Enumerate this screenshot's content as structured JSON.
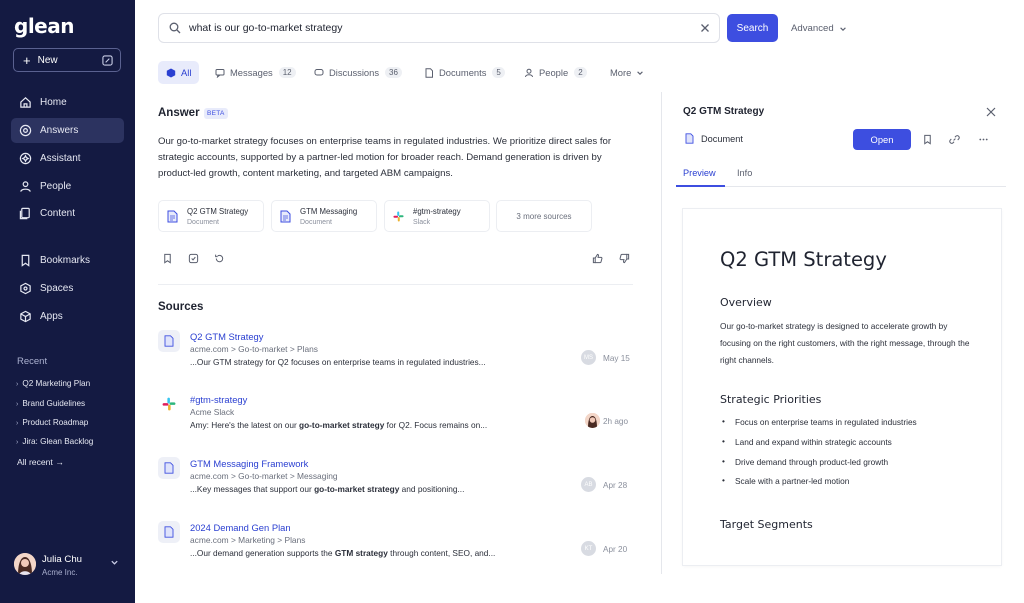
{
  "brand": {
    "logo": "glean",
    "primary_color": "#3d4ee0",
    "sidebar_color": "#141a42"
  },
  "sidebar": {
    "new_label": "New",
    "nav": [
      {
        "label": "Home",
        "icon": "home-icon"
      },
      {
        "label": "Answers",
        "icon": "answers-icon"
      },
      {
        "label": "Assistant",
        "icon": "assistant-icon"
      },
      {
        "label": "People",
        "icon": "people-icon"
      },
      {
        "label": "Content",
        "icon": "content-icon"
      }
    ],
    "nav2": [
      {
        "label": "Bookmarks",
        "icon": "bookmark-icon"
      },
      {
        "label": "Spaces",
        "icon": "spaces-icon"
      },
      {
        "label": "Apps",
        "icon": "apps-icon"
      }
    ],
    "recent_title": "Recent",
    "recent": [
      "Q2 Marketing Plan",
      "Brand Guidelines",
      "Product Roadmap",
      "Jira: Glean Backlog"
    ],
    "all_recent": "All recent →",
    "user": {
      "name": "Julia Chu",
      "org": "Acme Inc."
    }
  },
  "search": {
    "query": "what is our go-to-market strategy",
    "button": "Search",
    "advanced": "Advanced"
  },
  "tabs": [
    {
      "label": "All",
      "count": ""
    },
    {
      "label": "Messages",
      "count": "12"
    },
    {
      "label": "Discussions",
      "count": "36"
    },
    {
      "label": "Documents",
      "count": "5"
    },
    {
      "label": "People",
      "count": "2"
    },
    {
      "label": "More",
      "count": ""
    }
  ],
  "answer": {
    "title": "Answer",
    "badge": "BETA",
    "text": "Our go-to-market strategy focuses on enterprise teams in regulated industries. We prioritize direct sales for strategic accounts, supported by a partner-led motion for broader reach. Demand generation is driven by product-led growth, content marketing, and targeted ABM campaigns.",
    "cards": [
      {
        "title": "Q2 GTM Strategy",
        "sub": "Document"
      },
      {
        "title": "GTM Messaging",
        "sub": "Document"
      },
      {
        "title": "#gtm-strategy",
        "sub": "Slack"
      }
    ],
    "more_sources": "3 more sources"
  },
  "sources": {
    "title": "Sources",
    "items": [
      {
        "title": "Q2 GTM Strategy",
        "path": "acme.com  >  Go-to-market  >  Plans",
        "snippet_pre": "...Our GTM strategy for Q2 focuses on enterprise teams in regulated industries...",
        "avatar": "MS",
        "time": "May 15"
      },
      {
        "title": "#gtm-strategy",
        "path": "Acme Slack",
        "snippet_pre": "Amy: Here's the latest on our ",
        "snippet_bold": "go-to-market strategy",
        "snippet_post": " for Q2. Focus remains on...",
        "avatar": "",
        "time": "2h ago"
      },
      {
        "title": "GTM Messaging Framework",
        "path": "acme.com  >  Go-to-market  >  Messaging",
        "snippet_pre": "...Key messages that support our ",
        "snippet_bold": "go-to-market strategy",
        "snippet_post": " and positioning...",
        "avatar": "AB",
        "time": "Apr 28"
      },
      {
        "title": "2024 Demand Gen Plan",
        "path": "acme.com  >  Marketing  >  Plans",
        "snippet_pre": "...Our demand generation supports the ",
        "snippet_bold": "GTM strategy",
        "snippet_post": " through content, SEO, and...",
        "avatar": "KT",
        "time": "Apr 20"
      }
    ]
  },
  "preview": {
    "title": "Q2 GTM Strategy",
    "type": "Document",
    "open": "Open",
    "tabs": [
      "Preview",
      "Info"
    ],
    "doc": {
      "h1": "Q2 GTM Strategy",
      "overview_title": "Overview",
      "overview_text": "Our go-to-market strategy is designed to accelerate growth by focusing on the right customers, with the right message, through the right channels.",
      "priorities_title": "Strategic Priorities",
      "priorities": [
        "Focus on enterprise teams in regulated industries",
        "Land and expand within strategic accounts",
        "Drive demand through product-led growth",
        "Scale with a partner-led motion"
      ],
      "segments_title": "Target Segments"
    }
  }
}
